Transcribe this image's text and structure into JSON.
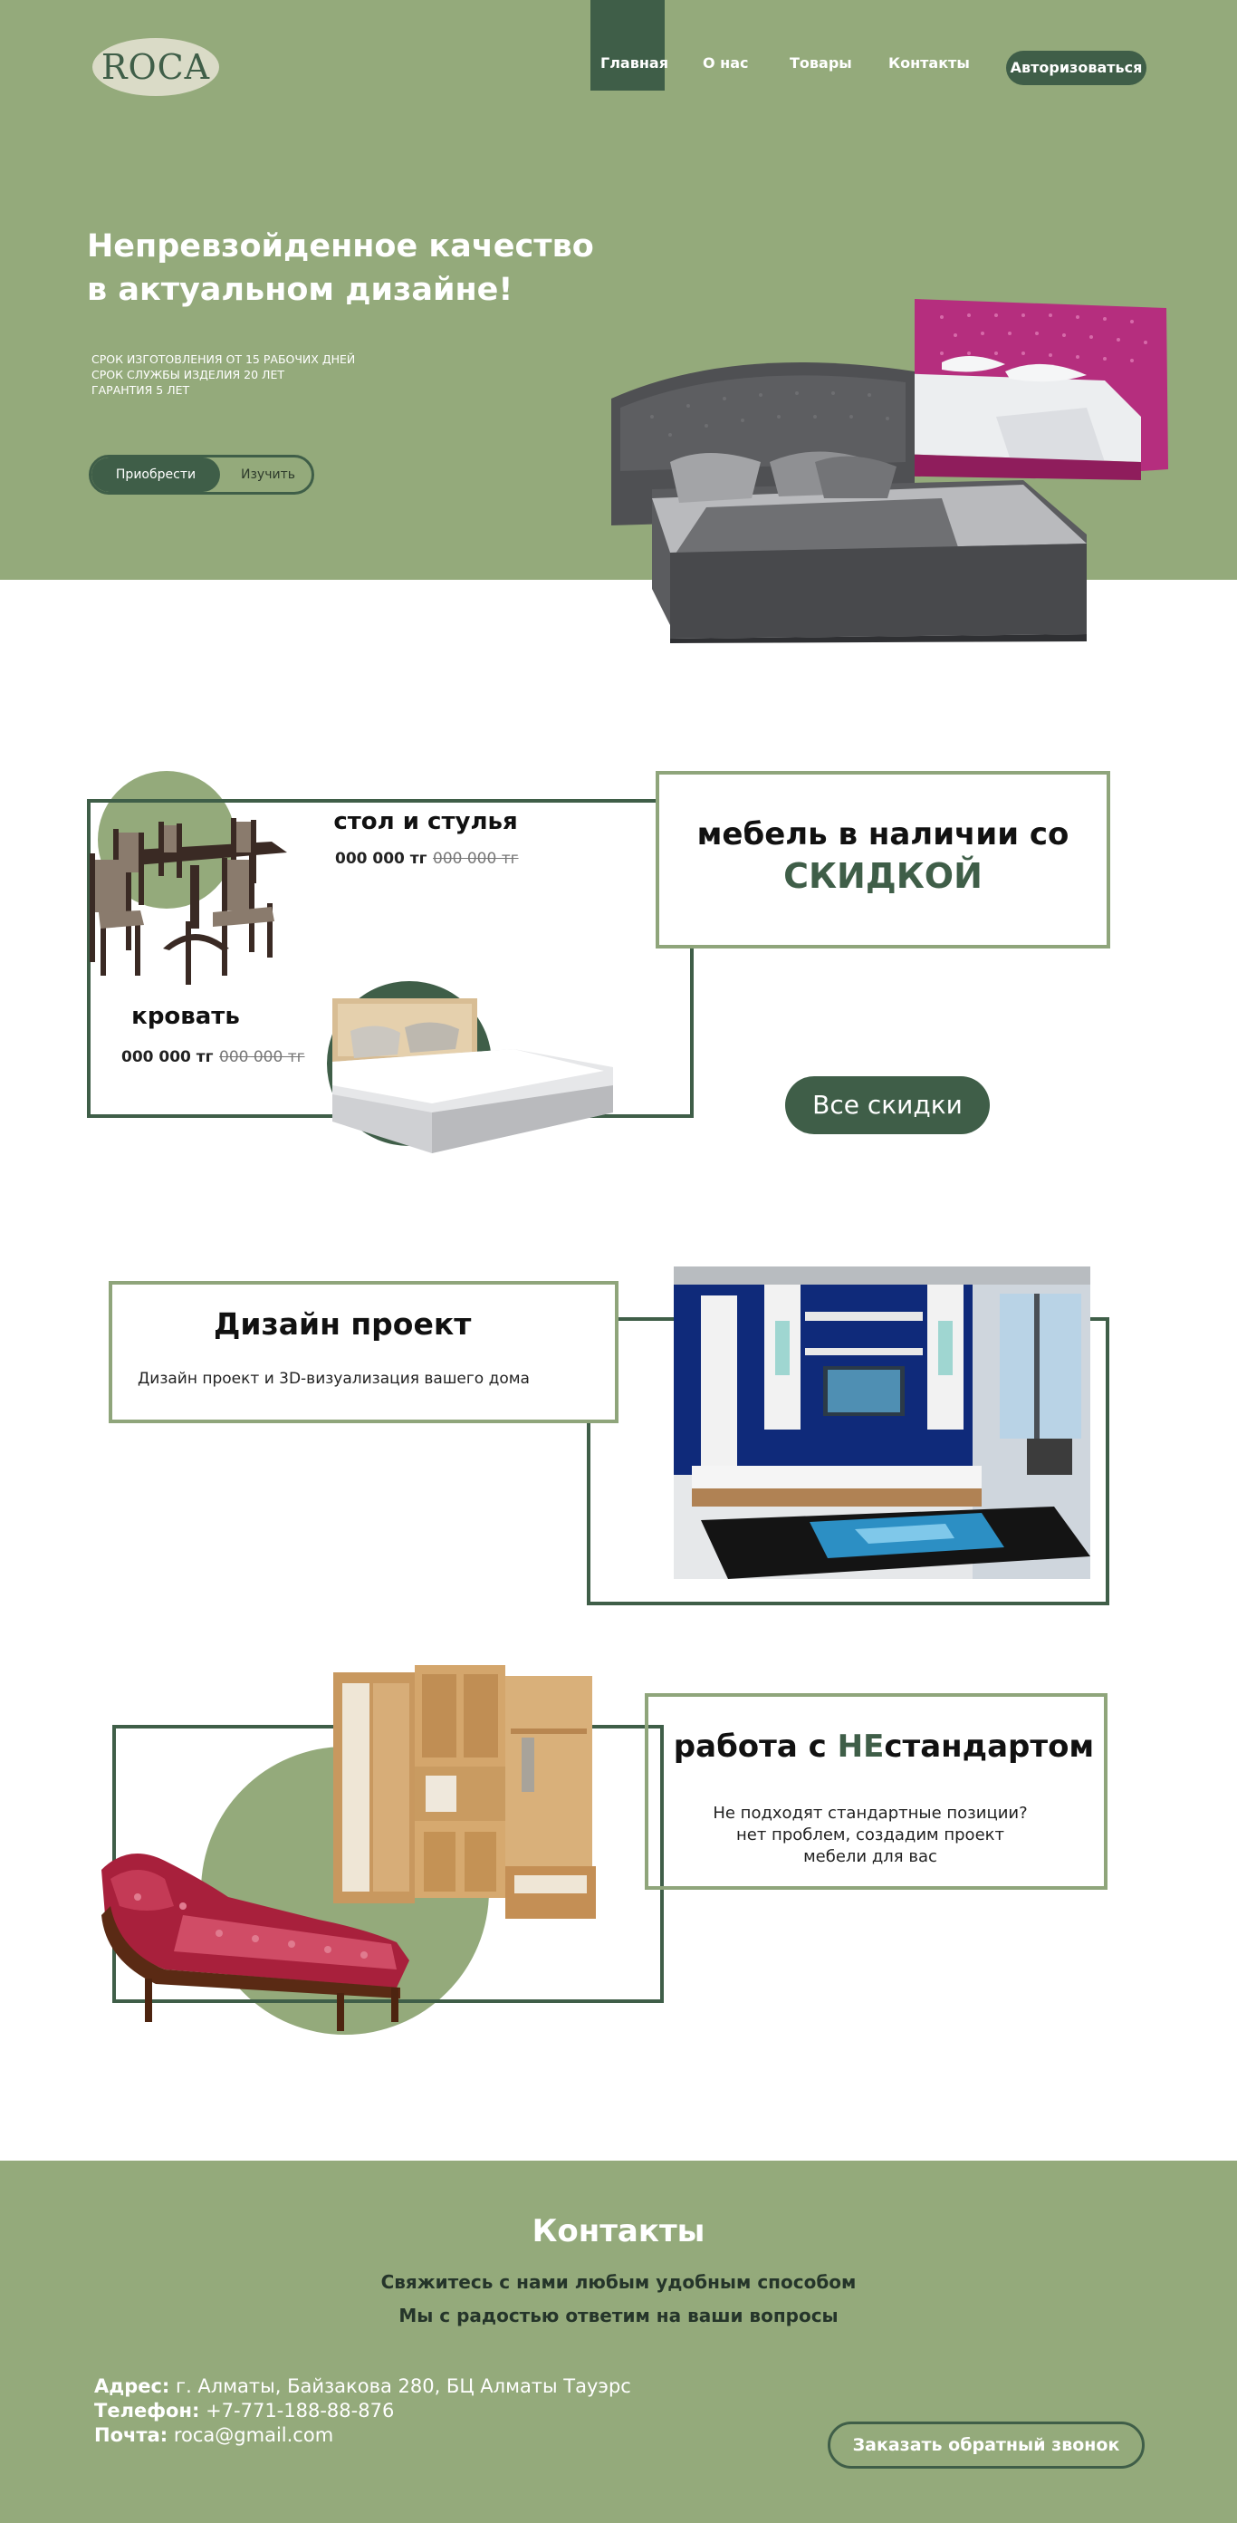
{
  "header": {
    "logo_text": "ROCA",
    "nav": [
      "Главная",
      "О нас",
      "Товары",
      "Контакты"
    ],
    "active_nav": "Главная",
    "auth_button": "Авторизоваться"
  },
  "hero": {
    "title_line1": "Непревзойденное качество",
    "title_line2": "в актуальном дизайне!",
    "facts": [
      "СРОК ИЗГОТОВЛЕНИЯ ОТ 15 РАБОЧИХ ДНЕЙ",
      "СРОК СЛУЖБЫ ИЗДЕЛИЯ 20 ЛЕТ",
      "ГАРАНТИЯ 5 ЛЕТ"
    ],
    "buy_button": "Приобрести",
    "learn_button": "Изучить"
  },
  "sale": {
    "items": [
      {
        "name": "стол и стулья",
        "price": "000 000 тг",
        "old_price": "000 000 тг"
      },
      {
        "name": "кровать",
        "price": "000 000 тг",
        "old_price": "000 000 тг"
      }
    ],
    "headline_line1": "мебель в наличии со",
    "headline_line2": "СКИДКОЙ",
    "all_discounts_button": "Все скидки"
  },
  "design": {
    "title": "Дизайн проект",
    "subtitle": "Дизайн проект и 3D-визуализация вашего дома"
  },
  "custom": {
    "title_part1": "работа с ",
    "title_highlight": "НЕ",
    "title_part2": "стандартом",
    "text_line1": "Не подходят стандартные позиции?",
    "text_line2": "нет проблем, создадим проект",
    "text_line3": "мебели для вас"
  },
  "contacts": {
    "title": "Контакты",
    "line1": "Свяжитесь с нами любым удобным способом",
    "line2": "Мы с радостью ответим на ваши вопросы",
    "address_label": "Адрес:",
    "address": "г. Алматы, Байзакова 280, БЦ Алматы Тауэрс",
    "phone_label": "Телефон:",
    "phone": "+7-771-188-88-876",
    "email_label": "Почта:",
    "email": "roca@gmail.com",
    "callback_button": "Заказать обратный звонок"
  },
  "colors": {
    "brand_green": "#94aa7b",
    "dark_green": "#3f5e48",
    "light_frame": "#8fa57b"
  }
}
